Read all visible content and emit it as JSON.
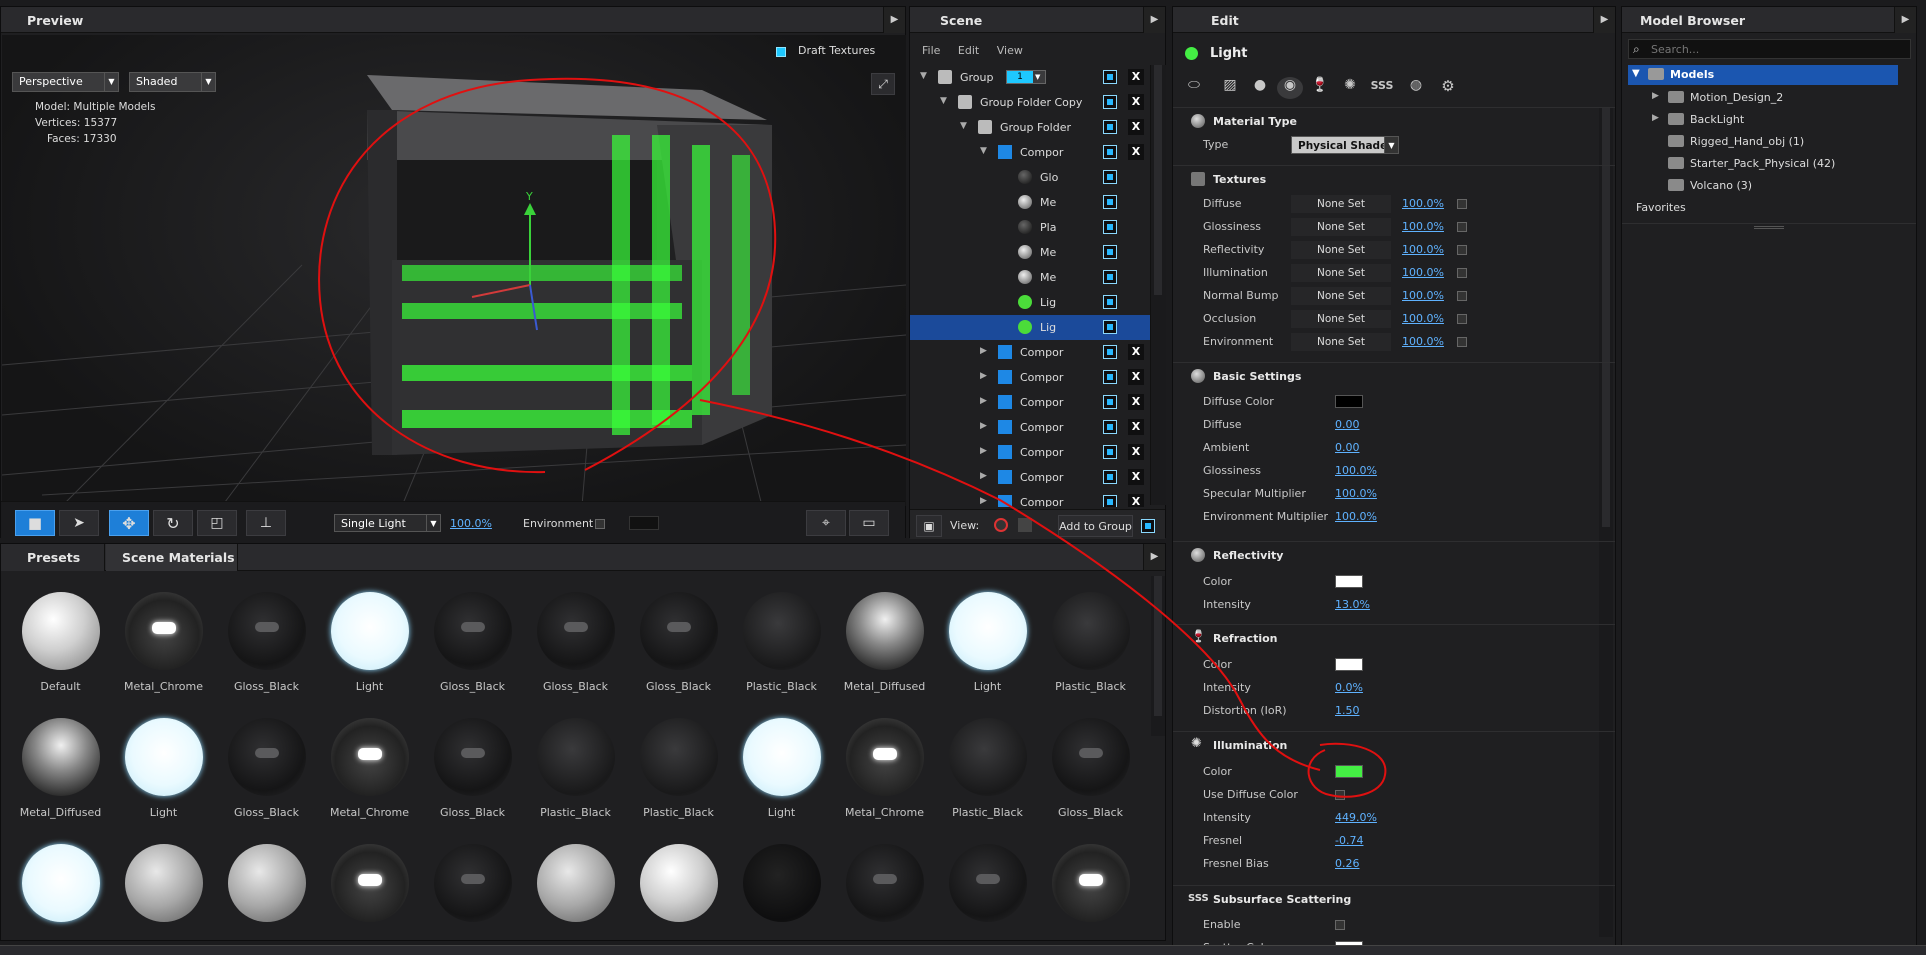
{
  "preview": {
    "title": "Preview",
    "draft_textures": "Draft Textures",
    "camera": "Perspective",
    "render_mode": "Shaded",
    "model_label": "Model:",
    "model_value": "Multiple Models",
    "vertices_label": "Vertices:",
    "vertices_value": "15377",
    "faces_label": "Faces:",
    "faces_value": "17330",
    "light_mode": "Single Light",
    "light_pct": "100.0%",
    "environment_label": "Environment"
  },
  "scene": {
    "title": "Scene",
    "menu": [
      "File",
      "Edit",
      "View"
    ],
    "group_level": "1",
    "rows": [
      {
        "label": "Group Fol",
        "indent": 0,
        "icon": "folder",
        "x": true
      },
      {
        "label": "Group Folder Copy",
        "indent": 1,
        "icon": "folder",
        "x": true
      },
      {
        "label": "Group Folder",
        "indent": 2,
        "icon": "folder",
        "x": true
      },
      {
        "label": "Compor",
        "indent": 3,
        "icon": "cube",
        "x": true
      },
      {
        "label": "Glo",
        "indent": 4,
        "icon": "ball-dark",
        "x": false
      },
      {
        "label": "Me",
        "indent": 4,
        "icon": "ball-grey",
        "x": false
      },
      {
        "label": "Pla",
        "indent": 4,
        "icon": "ball-dark",
        "x": false
      },
      {
        "label": "Me",
        "indent": 4,
        "icon": "ball-grey",
        "x": false
      },
      {
        "label": "Me",
        "indent": 4,
        "icon": "ball-grey",
        "x": false
      },
      {
        "label": "Lig",
        "indent": 4,
        "icon": "ball-green",
        "x": false
      },
      {
        "label": "Lig",
        "indent": 4,
        "icon": "ball-green",
        "x": false,
        "selected": true
      },
      {
        "label": "Compor",
        "indent": 3,
        "icon": "cube",
        "x": true,
        "collapsed": true
      },
      {
        "label": "Compor",
        "indent": 3,
        "icon": "cube",
        "x": true,
        "collapsed": true
      },
      {
        "label": "Compor",
        "indent": 3,
        "icon": "cube",
        "x": true,
        "collapsed": true
      },
      {
        "label": "Compor",
        "indent": 3,
        "icon": "cube",
        "x": true,
        "collapsed": true
      },
      {
        "label": "Compor",
        "indent": 3,
        "icon": "cube",
        "x": true,
        "collapsed": true
      },
      {
        "label": "Compor",
        "indent": 3,
        "icon": "cube",
        "x": true,
        "collapsed": true
      },
      {
        "label": "Compor",
        "indent": 3,
        "icon": "cube",
        "x": true,
        "collapsed": true
      }
    ],
    "view_label": "View:",
    "add_to_group": "Add to Group"
  },
  "edit": {
    "title": "Edit",
    "material_name": "Light",
    "material_color": "#44ee44",
    "material_type": {
      "title": "Material Type",
      "type_label": "Type",
      "type_value": "Physical Shader"
    },
    "textures": {
      "title": "Textures",
      "rows": [
        {
          "label": "Diffuse",
          "value": "None Set",
          "pct": "100.0%"
        },
        {
          "label": "Glossiness",
          "value": "None Set",
          "pct": "100.0%"
        },
        {
          "label": "Reflectivity",
          "value": "None Set",
          "pct": "100.0%"
        },
        {
          "label": "Illumination",
          "value": "None Set",
          "pct": "100.0%"
        },
        {
          "label": "Normal Bump",
          "value": "None Set",
          "pct": "100.0%"
        },
        {
          "label": "Occlusion",
          "value": "None Set",
          "pct": "100.0%"
        },
        {
          "label": "Environment",
          "value": "None Set",
          "pct": "100.0%"
        }
      ]
    },
    "basic": {
      "title": "Basic Settings",
      "diffuse_color_label": "Diffuse Color",
      "diffuse_color": "#000000",
      "rows": [
        {
          "label": "Diffuse",
          "value": "0.00"
        },
        {
          "label": "Ambient",
          "value": "0.00"
        },
        {
          "label": "Glossiness",
          "value": "100.0%"
        },
        {
          "label": "Specular Multiplier",
          "value": "100.0%"
        },
        {
          "label": "Environment Multiplier",
          "value": "100.0%"
        }
      ]
    },
    "reflectivity": {
      "title": "Reflectivity",
      "color_label": "Color",
      "color": "#ffffff",
      "intensity_label": "Intensity",
      "intensity": "13.0%"
    },
    "refraction": {
      "title": "Refraction",
      "color_label": "Color",
      "color": "#ffffff",
      "intensity_label": "Intensity",
      "intensity": "0.0%",
      "ior_label": "Distortion (IoR)",
      "ior": "1.50"
    },
    "illumination": {
      "title": "Illumination",
      "color_label": "Color",
      "color": "#44ee44",
      "use_diffuse_label": "Use Diffuse Color",
      "intensity_label": "Intensity",
      "intensity": "449.0%",
      "fresnel_label": "Fresnel",
      "fresnel": "-0.74",
      "fresnel_bias_label": "Fresnel Bias",
      "fresnel_bias": "0.26"
    },
    "sss": {
      "title": "Subsurface Scattering",
      "enable_label": "Enable",
      "scatter_label": "Scatter Color"
    }
  },
  "model_browser": {
    "title": "Model Browser",
    "search_placeholder": "Search...",
    "root": "Models",
    "items": [
      {
        "label": "Motion_Design_2",
        "expandable": true
      },
      {
        "label": "BackLight",
        "expandable": true
      },
      {
        "label": "Rigged_Hand_obj (1)",
        "expandable": false
      },
      {
        "label": "Starter_Pack_Physical (42)",
        "expandable": false
      },
      {
        "label": "Volcano (3)",
        "expandable": false
      }
    ],
    "favorites": "Favorites"
  },
  "materials": {
    "tabs": [
      "Presets",
      "Scene Materials"
    ],
    "items": [
      {
        "name": "Default",
        "style": "white"
      },
      {
        "name": "Metal_Chrome",
        "style": "chrome"
      },
      {
        "name": "Gloss_Black",
        "style": "gloss"
      },
      {
        "name": "Light",
        "style": "light"
      },
      {
        "name": "Gloss_Black",
        "style": "gloss"
      },
      {
        "name": "Gloss_Black",
        "style": "gloss"
      },
      {
        "name": "Gloss_Black",
        "style": "gloss"
      },
      {
        "name": "Plastic_Black",
        "style": "plastic"
      },
      {
        "name": "Metal_Diffused",
        "style": "diffused"
      },
      {
        "name": "Light",
        "style": "light"
      },
      {
        "name": "Plastic_Black",
        "style": "plastic"
      },
      {
        "name": "Metal_Diffused",
        "style": "diffused"
      },
      {
        "name": "Light",
        "style": "light"
      },
      {
        "name": "Gloss_Black",
        "style": "gloss"
      },
      {
        "name": "Metal_Chrome",
        "style": "chrome"
      },
      {
        "name": "Gloss_Black",
        "style": "gloss"
      },
      {
        "name": "Plastic_Black",
        "style": "plastic"
      },
      {
        "name": "Plastic_Black",
        "style": "plastic"
      },
      {
        "name": "Light",
        "style": "light"
      },
      {
        "name": "Metal_Chrome",
        "style": "chrome"
      },
      {
        "name": "Plastic_Black",
        "style": "plastic"
      },
      {
        "name": "Gloss_Black",
        "style": "gloss"
      },
      {
        "name": "",
        "style": "light"
      },
      {
        "name": "",
        "style": "grey"
      },
      {
        "name": "",
        "style": "grey"
      },
      {
        "name": "",
        "style": "chrome"
      },
      {
        "name": "",
        "style": "gloss"
      },
      {
        "name": "",
        "style": "grey"
      },
      {
        "name": "",
        "style": "white"
      },
      {
        "name": "",
        "style": "dark"
      },
      {
        "name": "",
        "style": "gloss"
      },
      {
        "name": "",
        "style": "gloss"
      },
      {
        "name": "",
        "style": "chrome"
      }
    ]
  },
  "annotation_color": "#e01010"
}
